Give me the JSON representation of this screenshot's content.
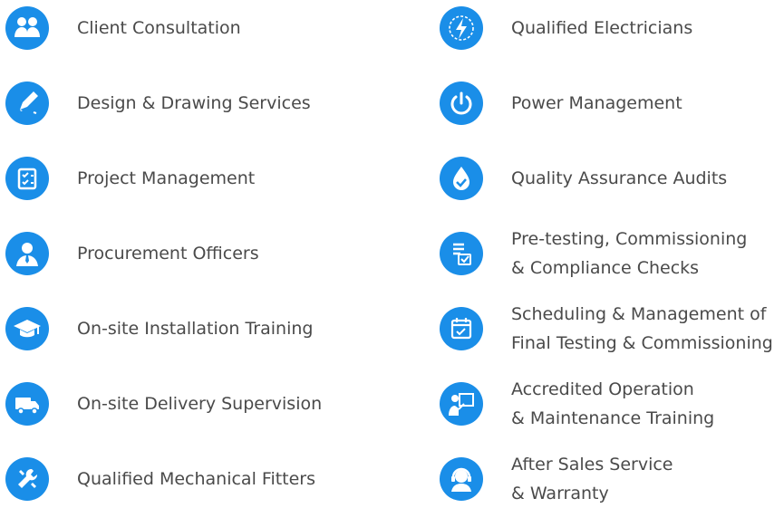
{
  "accent_color": "#1a8ee8",
  "text_color": "#4a4a4a",
  "left_items": [
    {
      "label": "Client Consultation",
      "icon": "consultation-icon"
    },
    {
      "label": "Design & Drawing Services",
      "icon": "pencil-icon"
    },
    {
      "label": "Project Management",
      "icon": "checklist-icon"
    },
    {
      "label": "Procurement Officers",
      "icon": "person-tie-icon"
    },
    {
      "label": "On-site Installation Training",
      "icon": "graduation-cap-icon"
    },
    {
      "label": "On-site Delivery Supervision",
      "icon": "truck-icon"
    },
    {
      "label": "Qualified Mechanical Fitters",
      "icon": "wrench-icon"
    }
  ],
  "right_items": [
    {
      "label": "Qualified Electricians",
      "icon": "lightning-icon"
    },
    {
      "label": "Power Management",
      "icon": "power-icon"
    },
    {
      "label": "Quality Assurance Audits",
      "icon": "drop-check-icon"
    },
    {
      "line1": "Pre-testing, Commissioning",
      "line2": "& Compliance Checks",
      "icon": "document-check-icon"
    },
    {
      "line1": "Scheduling & Management of",
      "line2": "Final Testing & Commissioning",
      "icon": "calendar-check-icon"
    },
    {
      "line1": "Accredited Operation",
      "line2": "& Maintenance Training",
      "icon": "presentation-icon"
    },
    {
      "line1": "After Sales Service",
      "line2": "& Warranty",
      "icon": "support-agent-icon"
    }
  ]
}
